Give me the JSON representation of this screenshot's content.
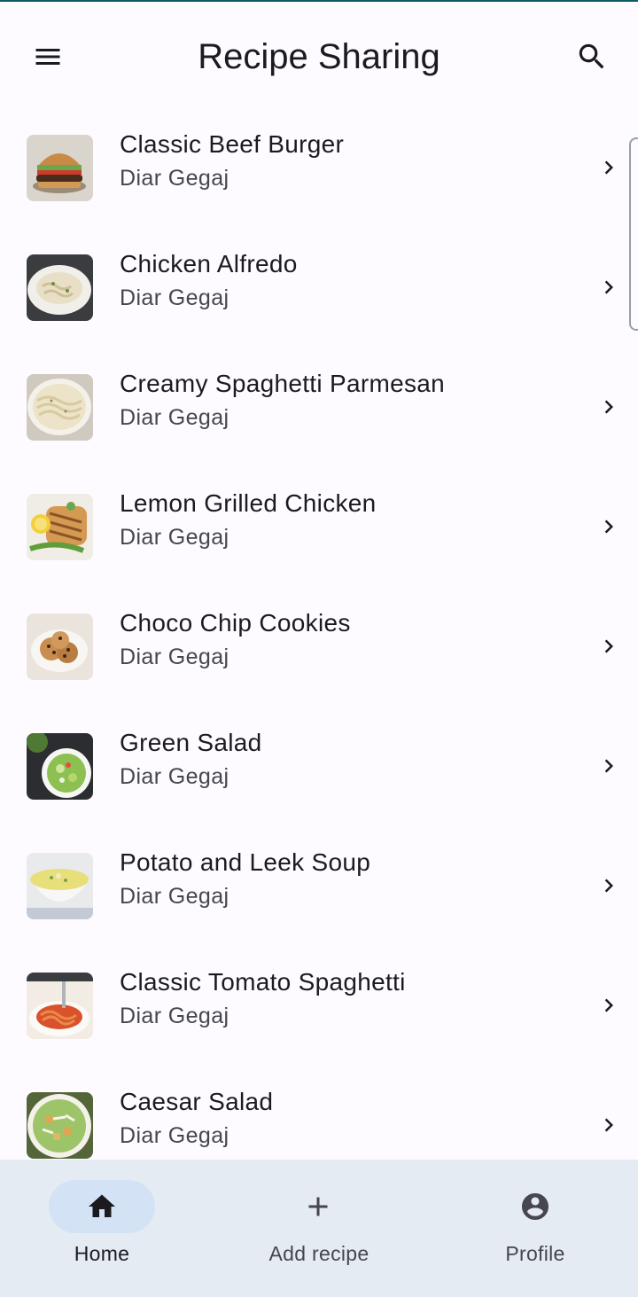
{
  "app": {
    "title": "Recipe Sharing",
    "menu_icon": "menu-icon",
    "search_icon": "search-icon"
  },
  "recipes": [
    {
      "name": "Classic Beef Burger",
      "author": "Diar Gegaj",
      "thumb": "burger"
    },
    {
      "name": "Chicken Alfredo",
      "author": "Diar Gegaj",
      "thumb": "alfredo"
    },
    {
      "name": "Creamy Spaghetti Parmesan",
      "author": "Diar Gegaj",
      "thumb": "parmesan"
    },
    {
      "name": "Lemon Grilled Chicken",
      "author": "Diar Gegaj",
      "thumb": "chicken"
    },
    {
      "name": "Choco Chip Cookies",
      "author": "Diar Gegaj",
      "thumb": "cookies"
    },
    {
      "name": "Green Salad",
      "author": "Diar Gegaj",
      "thumb": "green-salad"
    },
    {
      "name": "Potato and Leek Soup",
      "author": "Diar Gegaj",
      "thumb": "soup"
    },
    {
      "name": "Classic Tomato Spaghetti",
      "author": "Diar Gegaj",
      "thumb": "tomato-spaghetti"
    },
    {
      "name": "Caesar Salad",
      "author": "Diar Gegaj",
      "thumb": "caesar"
    }
  ],
  "bottom_nav": [
    {
      "label": "Home",
      "icon": "home-icon",
      "active": true
    },
    {
      "label": "Add recipe",
      "icon": "plus-icon",
      "active": false
    },
    {
      "label": "Profile",
      "icon": "account-circle-icon",
      "active": false
    }
  ],
  "colors": {
    "background": "#fdfbff",
    "nav_background": "#e5ebf3",
    "active_pill": "#d3e3f5",
    "text_primary": "#1b1b1f",
    "text_secondary": "#45464f"
  }
}
